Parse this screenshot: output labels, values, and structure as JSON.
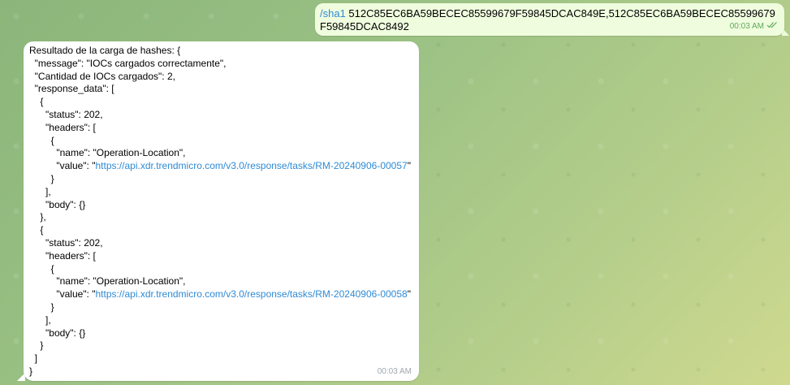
{
  "outgoing": {
    "command": "/sha1",
    "text": " 512C85EC6BA59BECEC85599679F59845DCAC849E,512C85EC6BA59BECEC85599679F59845DCAC8492",
    "time": "00:03 AM",
    "status_icon": "double-check-icon"
  },
  "incoming": {
    "time": "00:03 AM",
    "lines": [
      {
        "pre": "Resultado de la carga de hashes: {",
        "link": "",
        "post": ""
      },
      {
        "pre": "  \"message\": \"IOCs cargados correctamente\",",
        "link": "",
        "post": ""
      },
      {
        "pre": "  \"Cantidad de IOCs cargados\": 2,",
        "link": "",
        "post": ""
      },
      {
        "pre": "  \"response_data\": [",
        "link": "",
        "post": ""
      },
      {
        "pre": "    {",
        "link": "",
        "post": ""
      },
      {
        "pre": "      \"status\": 202,",
        "link": "",
        "post": ""
      },
      {
        "pre": "      \"headers\": [",
        "link": "",
        "post": ""
      },
      {
        "pre": "        {",
        "link": "",
        "post": ""
      },
      {
        "pre": "          \"name\": \"Operation-Location\",",
        "link": "",
        "post": ""
      },
      {
        "pre": "          \"value\": \"",
        "link": "https://api.xdr.trendmicro.com/v3.0/response/tasks/RM-20240906-00057",
        "post": "\""
      },
      {
        "pre": "        }",
        "link": "",
        "post": ""
      },
      {
        "pre": "      ],",
        "link": "",
        "post": ""
      },
      {
        "pre": "      \"body\": {}",
        "link": "",
        "post": ""
      },
      {
        "pre": "    },",
        "link": "",
        "post": ""
      },
      {
        "pre": "    {",
        "link": "",
        "post": ""
      },
      {
        "pre": "      \"status\": 202,",
        "link": "",
        "post": ""
      },
      {
        "pre": "      \"headers\": [",
        "link": "",
        "post": ""
      },
      {
        "pre": "        {",
        "link": "",
        "post": ""
      },
      {
        "pre": "          \"name\": \"Operation-Location\",",
        "link": "",
        "post": ""
      },
      {
        "pre": "          \"value\": \"",
        "link": "https://api.xdr.trendmicro.com/v3.0/response/tasks/RM-20240906-00058",
        "post": "\""
      },
      {
        "pre": "        }",
        "link": "",
        "post": ""
      },
      {
        "pre": "      ],",
        "link": "",
        "post": ""
      },
      {
        "pre": "      \"body\": {}",
        "link": "",
        "post": ""
      },
      {
        "pre": "    }",
        "link": "",
        "post": ""
      },
      {
        "pre": "  ]",
        "link": "",
        "post": ""
      },
      {
        "pre": "}",
        "link": "",
        "post": ""
      }
    ]
  }
}
